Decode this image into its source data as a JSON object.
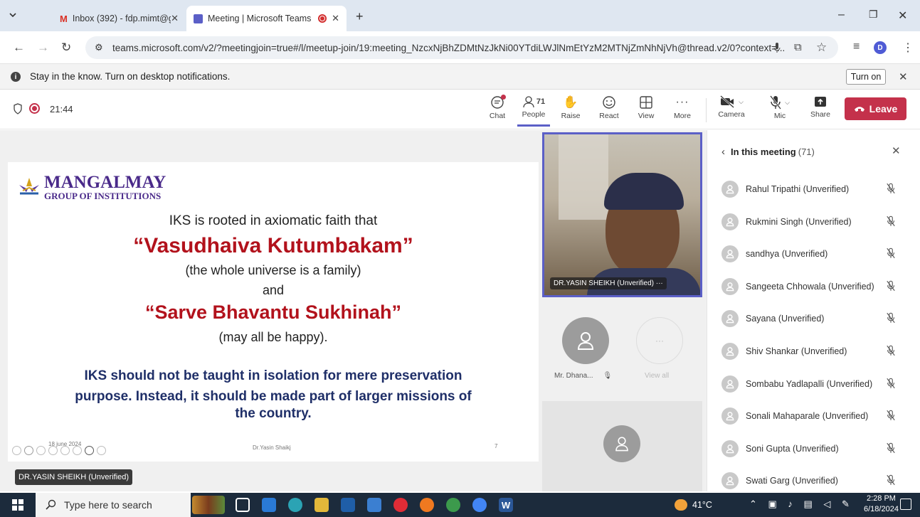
{
  "browser": {
    "tabs": [
      {
        "title": "Inbox (392) - fdp.mimt@gmail.c",
        "icon": "gmail-icon"
      },
      {
        "title": "Meeting | Microsoft Teams",
        "icon": "teams-icon"
      }
    ],
    "url": "teams.microsoft.com/v2/?meetingjoin=true#/l/meetup-join/19:meeting_NzcxNjBhZDMtNzJkNi00YTdiLWJlNmEtYzM2MTNjZmNhNjVh@thread.v2/0?context=...",
    "profile_initial": "D"
  },
  "notification": {
    "text": "Stay in the know. Turn on desktop notifications.",
    "button": "Turn on"
  },
  "meeting": {
    "timer": "21:44",
    "toolbar": [
      {
        "label": "Chat",
        "icon": "chat-icon"
      },
      {
        "label": "People",
        "icon": "people-icon",
        "count": "71"
      },
      {
        "label": "Raise",
        "icon": "hand-icon"
      },
      {
        "label": "React",
        "icon": "smile-icon"
      },
      {
        "label": "View",
        "icon": "grid-icon"
      },
      {
        "label": "More",
        "icon": "more-icon"
      },
      {
        "label": "Camera",
        "icon": "camera-off-icon"
      },
      {
        "label": "Mic",
        "icon": "mic-off-icon"
      },
      {
        "label": "Share",
        "icon": "share-icon"
      }
    ],
    "leave": "Leave"
  },
  "slide": {
    "logo_line1": "MANGALMAY",
    "logo_line2": "GROUP OF INSTITUTIONS",
    "line1": "IKS is rooted in axiomatic faith that",
    "quote1": "“Vasudhaiva Kutumbakam”",
    "line2": "(the whole universe is a family)",
    "line3": "and",
    "quote2": "“Sarve Bhavantu Sukhinah”",
    "line4": "(may all be happy).",
    "bold1": "IKS should not be taught in isolation for mere preservation",
    "bold2": "purpose. Instead, it should be made part of larger missions of",
    "bold3": "the country.",
    "footer_date": "18 june 2024",
    "footer_author": "Dr.Yasin Shaikj",
    "footer_page": "7"
  },
  "presenter_label": "DR.YASIN SHEIKH (Unverified)",
  "videos": {
    "main_label": "DR.YASIN SHEIKH (Unverified)  ···",
    "tile1_name": "Mr. Dhana...",
    "tile2_name": "View all"
  },
  "panel": {
    "title": "In this meeting",
    "count": "(71)",
    "people": [
      "Rahul Tripathi (Unverified)",
      "Rukmini Singh (Unverified)",
      "sandhya (Unverified)",
      "Sangeeta Chhowala (Unverified)",
      "Sayana (Unverified)",
      "Shiv Shankar (Unverified)",
      "Sombabu Yadlapalli (Unverified)",
      "Sonali Mahaparale (Unverified)",
      "Soni Gupta (Unverified)",
      "Swati Garg (Unverified)"
    ]
  },
  "taskbar": {
    "search_placeholder": "Type here to search",
    "weather": "41°C",
    "time": "2:28 PM",
    "date": "6/18/2024"
  },
  "colors": {
    "teams_purple": "#5b5fc7",
    "leave_red": "#c4314b",
    "slide_red": "#b2121c",
    "slide_blue": "#1f2f68"
  }
}
